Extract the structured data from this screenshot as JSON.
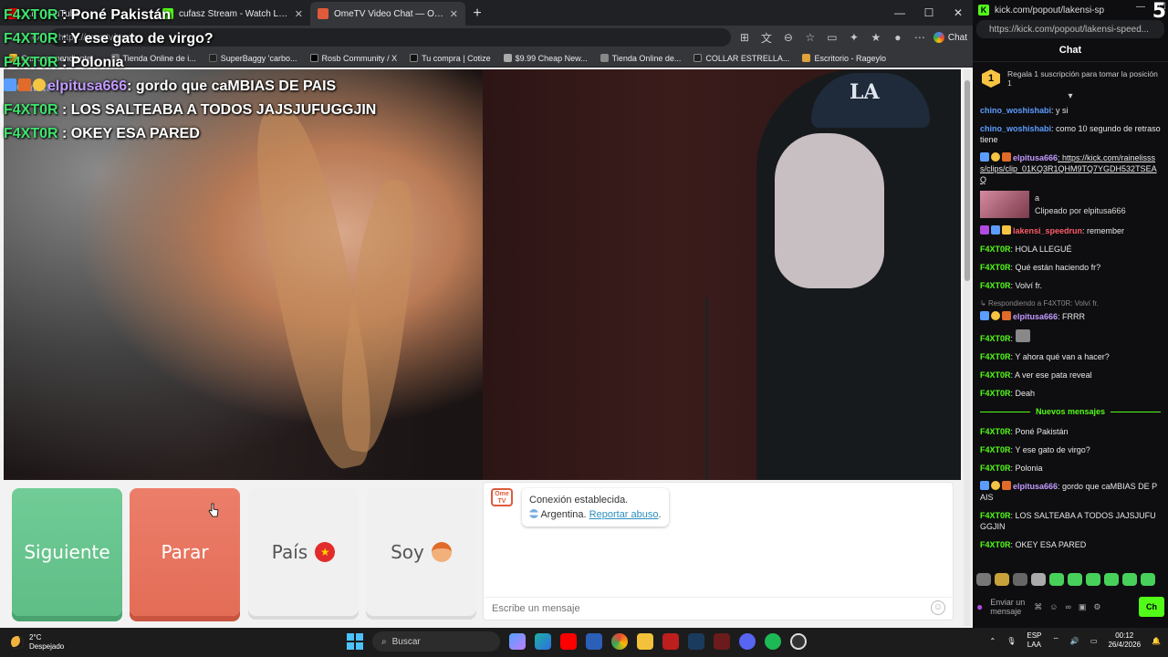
{
  "browser": {
    "tabs": [
      {
        "title": "...n - YouTube",
        "icon": "youtube-icon",
        "color": "#ff0000"
      },
      {
        "title": "cufasz Stream - Watch Live on Kick",
        "icon": "kick-icon",
        "color": "#53fc18"
      },
      {
        "title": "OmeTV Video Chat — Omegle",
        "icon": "ometv-icon",
        "color": "#e05a3c",
        "active": true
      }
    ],
    "new_tab": "+",
    "url": "https://ome.tv/#app",
    "chat_button": "Chat",
    "bookmarks": [
      "Carreras pendiente...",
      "Tienda Online de i...",
      "SuperBaggy 'carbo...",
      "Rosb Community / X",
      "Tu compra | Cotize",
      "$9.99 Cheap New...",
      "Tienda Online de...",
      "COLLAR ESTRELLA...",
      "Escritorio - Rageylo"
    ]
  },
  "overlay": [
    {
      "name": "F4XT0R",
      "text": " : Poné Pakistán",
      "color": "green"
    },
    {
      "name": "F4XT0R",
      "text": " : Y ese gato de virgo?",
      "color": "green"
    },
    {
      "name": "F4XT0R",
      "text": " : Polonia",
      "color": "green"
    },
    {
      "name": "elpitusa666",
      "text": ": gordo que caMBIAS DE PAIS",
      "color": "purple"
    },
    {
      "name": "F4XT0R",
      "text": " : LOS SALTEABA A TODOS JAJSJUFUGGJIN",
      "color": "green"
    },
    {
      "name": "F4XT0R",
      "text": " : OKEY ESA PARED",
      "color": "green"
    }
  ],
  "ometv": {
    "watermark": "Ome.tv",
    "cap_logo": "LA",
    "buttons": {
      "next": "Siguiente",
      "stop": "Parar",
      "country": "País",
      "gender": "Soy"
    },
    "system": {
      "icon": "Ome TV",
      "line1": "Conexión establecida.",
      "country": "Argentina.",
      "report": "Reportar abuso",
      "period": "."
    },
    "input_placeholder": "Escribe un mensaje"
  },
  "kick": {
    "window_title": "kick.com/popout/lakensi-speedrun/chat",
    "url": "https://kick.com/popout/lakensi-speed...",
    "corner_number": "5",
    "chat_title": "Chat",
    "gift_badge": "1",
    "gift_text": "Regala 1 suscripción para tomar la posición 1",
    "messages_old": [
      {
        "user": "chino_woshishabi",
        "color": "blue",
        "text": ": y si"
      },
      {
        "user": "chino_woshishabi",
        "color": "blue",
        "text": ": como 10 segundo de retraso tiene"
      },
      {
        "user": "elpitusa666",
        "color": "purple",
        "text": ": https://kick.com/rainelissss/clips/clip_01KQ3R1QHM9TQ7YGDH532TSEAQ",
        "link": true
      }
    ],
    "clip": {
      "title": "a",
      "by": "Clipeado por elpitusa666"
    },
    "messages_mid": [
      {
        "user": "lakensi_speedrun",
        "color": "pink",
        "text": ": remember"
      },
      {
        "user": "F4XT0R",
        "color": "green",
        "text": ": HOLA LLEGUÉ"
      },
      {
        "user": "F4XT0R",
        "color": "green",
        "text": ": Qué están haciendo fr?"
      },
      {
        "user": "F4XT0R",
        "color": "green",
        "text": ": Volví fr."
      }
    ],
    "reply_context": "Respondiendo a F4XT0R: Volví fr.",
    "messages_after": [
      {
        "user": "elpitusa666",
        "color": "purple",
        "text": ": FRRR"
      },
      {
        "user": "F4XT0R",
        "color": "green",
        "text": ": "
      },
      {
        "user": "F4XT0R",
        "color": "green",
        "text": ": Y ahora qué van a hacer?"
      },
      {
        "user": "F4XT0R",
        "color": "green",
        "text": ": A ver ese pata reveal"
      },
      {
        "user": "F4XT0R",
        "color": "green",
        "text": ": Deah"
      }
    ],
    "new_messages_label": "Nuevos mensajes",
    "messages_new": [
      {
        "user": "F4XT0R",
        "color": "green",
        "text": ": Poné Pakistán"
      },
      {
        "user": "F4XT0R",
        "color": "green",
        "text": ": Y ese gato de virgo?"
      },
      {
        "user": "F4XT0R",
        "color": "green",
        "text": ": Polonia"
      },
      {
        "user": "elpitusa666",
        "color": "purple",
        "text": ": gordo que caMBIAS DE PAIS"
      },
      {
        "user": "F4XT0R",
        "color": "green",
        "text": ": LOS SALTEABA A TODOS JAJSJUFUGGJIN"
      },
      {
        "user": "F4XT0R",
        "color": "green",
        "text": ": OKEY ESA PARED"
      }
    ],
    "input_placeholder": "Enviar un mensaje",
    "send_label": "Ch"
  },
  "taskbar": {
    "weather_temp": "2°C",
    "weather_desc": "Despejado",
    "search": "Buscar",
    "lang1": "ESP",
    "lang2": "LAA",
    "time": "00:12",
    "date": "26/4/2026"
  }
}
